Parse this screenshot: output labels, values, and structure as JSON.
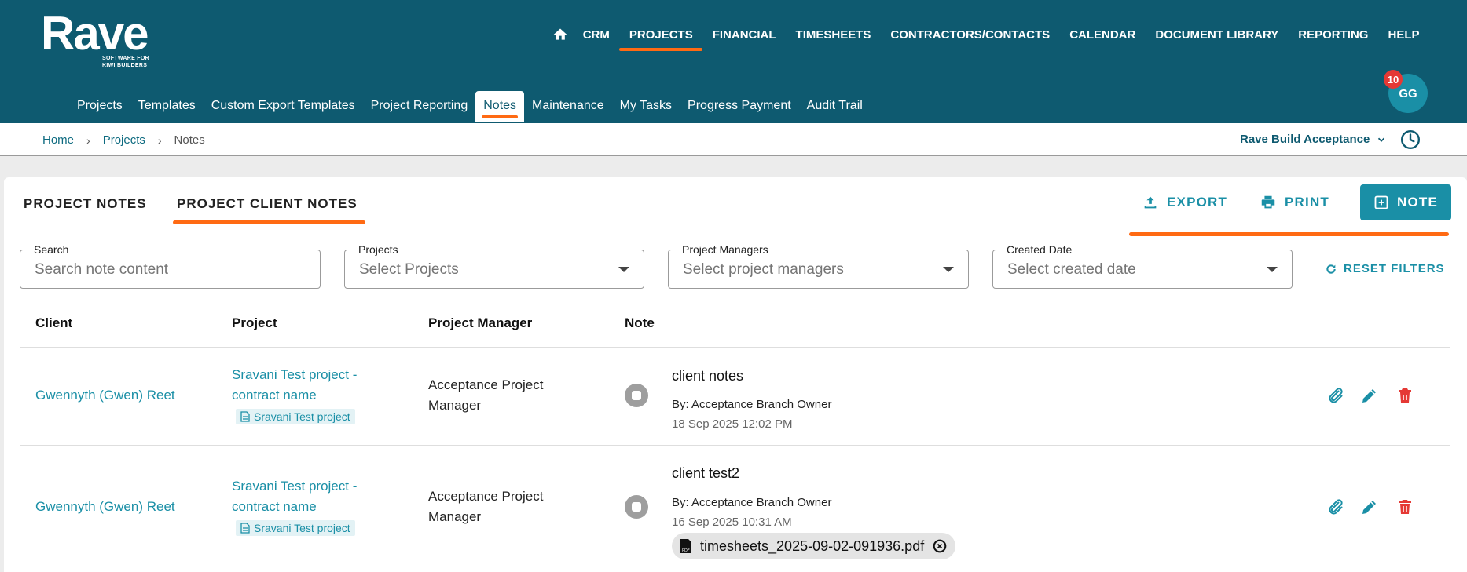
{
  "brand": {
    "name": "Rave",
    "tagline_1": "SOFTWARE FOR",
    "tagline_2": "KIWI BUILDERS"
  },
  "top_nav": [
    "CRM",
    "PROJECTS",
    "FINANCIAL",
    "TIMESHEETS",
    "CONTRACTORS/CONTACTS",
    "CALENDAR",
    "DOCUMENT LIBRARY",
    "REPORTING",
    "HELP"
  ],
  "sub_nav": [
    "Projects",
    "Templates",
    "Custom Export Templates",
    "Project Reporting",
    "Notes",
    "Maintenance",
    "My Tasks",
    "Progress Payment",
    "Audit Trail"
  ],
  "user": {
    "initials": "GG",
    "notifications": "10"
  },
  "breadcrumb": {
    "home": "Home",
    "projects": "Projects",
    "current": "Notes"
  },
  "company": "Rave Build Acceptance",
  "tabs": {
    "project_notes": "PROJECT NOTES",
    "project_client_notes": "PROJECT CLIENT NOTES"
  },
  "actions": {
    "export": "EXPORT",
    "print": "PRINT",
    "note": "NOTE"
  },
  "filters": {
    "search": {
      "label": "Search",
      "placeholder": "Search note content"
    },
    "projects": {
      "label": "Projects",
      "placeholder": "Select Projects"
    },
    "managers": {
      "label": "Project Managers",
      "placeholder": "Select project managers"
    },
    "created": {
      "label": "Created Date",
      "placeholder": "Select created date"
    },
    "reset": "RESET FILTERS"
  },
  "table": {
    "headers": {
      "client": "Client",
      "project": "Project",
      "manager": "Project Manager",
      "note": "Note"
    },
    "rows": [
      {
        "client": "Gwennyth (Gwen) Reet",
        "project_line1": "Sravani Test project -",
        "project_line2": "contract name",
        "project_chip": "Sravani Test project",
        "manager_line1": "Acceptance Project",
        "manager_line2": "Manager",
        "note_title": "client notes",
        "note_by": "By: Acceptance Branch Owner",
        "note_date": "18 Sep 2025 12:02 PM"
      },
      {
        "client": "Gwennyth (Gwen) Reet",
        "project_line1": "Sravani Test project -",
        "project_line2": "contract name",
        "project_chip": "Sravani Test project",
        "manager_line1": "Acceptance Project",
        "manager_line2": "Manager",
        "note_title": "client test2",
        "note_by": "By: Acceptance Branch Owner",
        "note_date": "16 Sep 2025 10:31 AM",
        "attachment": "timesheets_2025-09-02-091936.pdf"
      }
    ]
  },
  "colors": {
    "header": "#0e5a70",
    "accent": "#ff6a13",
    "teal": "#1a8fa6",
    "danger": "#e53935"
  }
}
